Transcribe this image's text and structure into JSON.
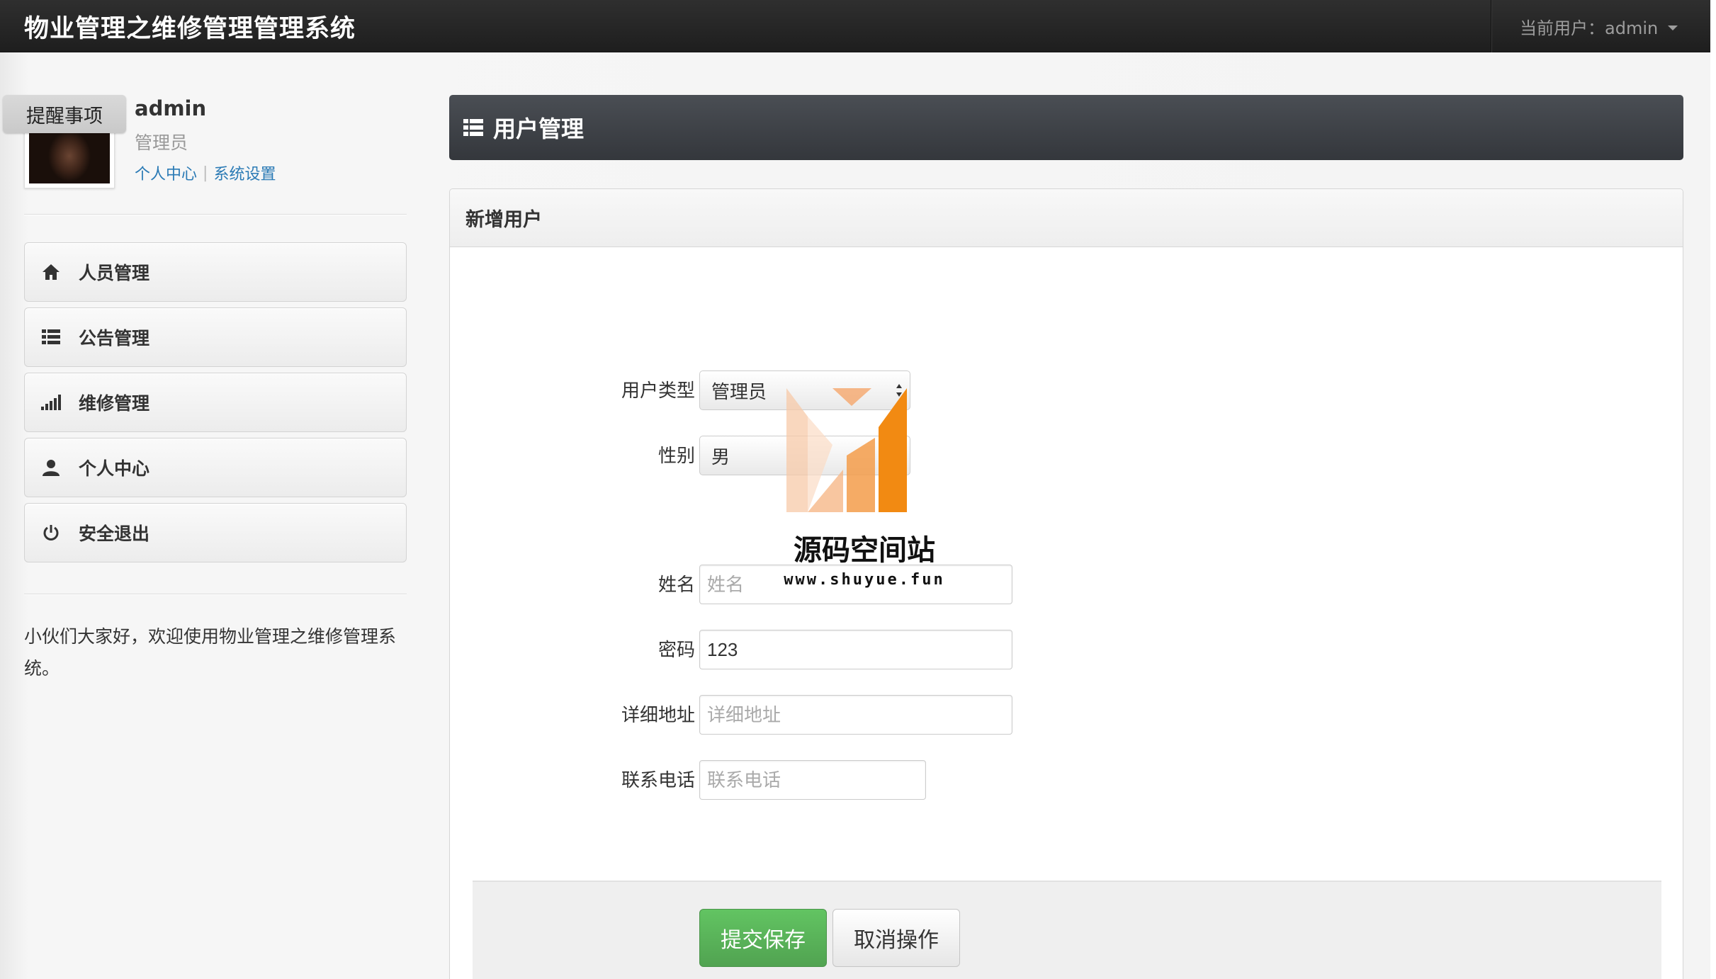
{
  "app": {
    "title": "物业管理之维修管理管理系统",
    "current_user_label": "当前用户：admin"
  },
  "sidebar": {
    "reminder_label": "提醒事项",
    "profile": {
      "name": "admin",
      "role": "管理员",
      "link_personal": "个人中心",
      "link_settings": "系统设置"
    },
    "items": [
      {
        "label": "人员管理",
        "icon": "home-icon"
      },
      {
        "label": "公告管理",
        "icon": "list-icon"
      },
      {
        "label": "维修管理",
        "icon": "signal-icon"
      },
      {
        "label": "个人中心",
        "icon": "user-icon"
      },
      {
        "label": "安全退出",
        "icon": "power-icon"
      }
    ],
    "welcome_text": "小伙们大家好，欢迎使用物业管理之维修管理系统。"
  },
  "main": {
    "page_title": "用户管理",
    "panel_title": "新增用户",
    "form": {
      "user_type": {
        "label": "用户类型",
        "value": "管理员"
      },
      "gender": {
        "label": "性别",
        "value": "男"
      },
      "name": {
        "label": "姓名",
        "value": "",
        "placeholder": "姓名"
      },
      "password": {
        "label": "密码",
        "value": "123"
      },
      "address": {
        "label": "详细地址",
        "value": "",
        "placeholder": "详细地址"
      },
      "phone": {
        "label": "联系电话",
        "value": "",
        "placeholder": "联系电话"
      }
    },
    "buttons": {
      "save": "提交保存",
      "cancel": "取消操作"
    }
  },
  "watermark": {
    "title": "源码空间站",
    "url": "www.shuyue.fun"
  },
  "colors": {
    "topbar": "#222222",
    "link": "#2a7ab5",
    "save_button": "#5bb75b",
    "watermark_orange": "#f39c12"
  }
}
